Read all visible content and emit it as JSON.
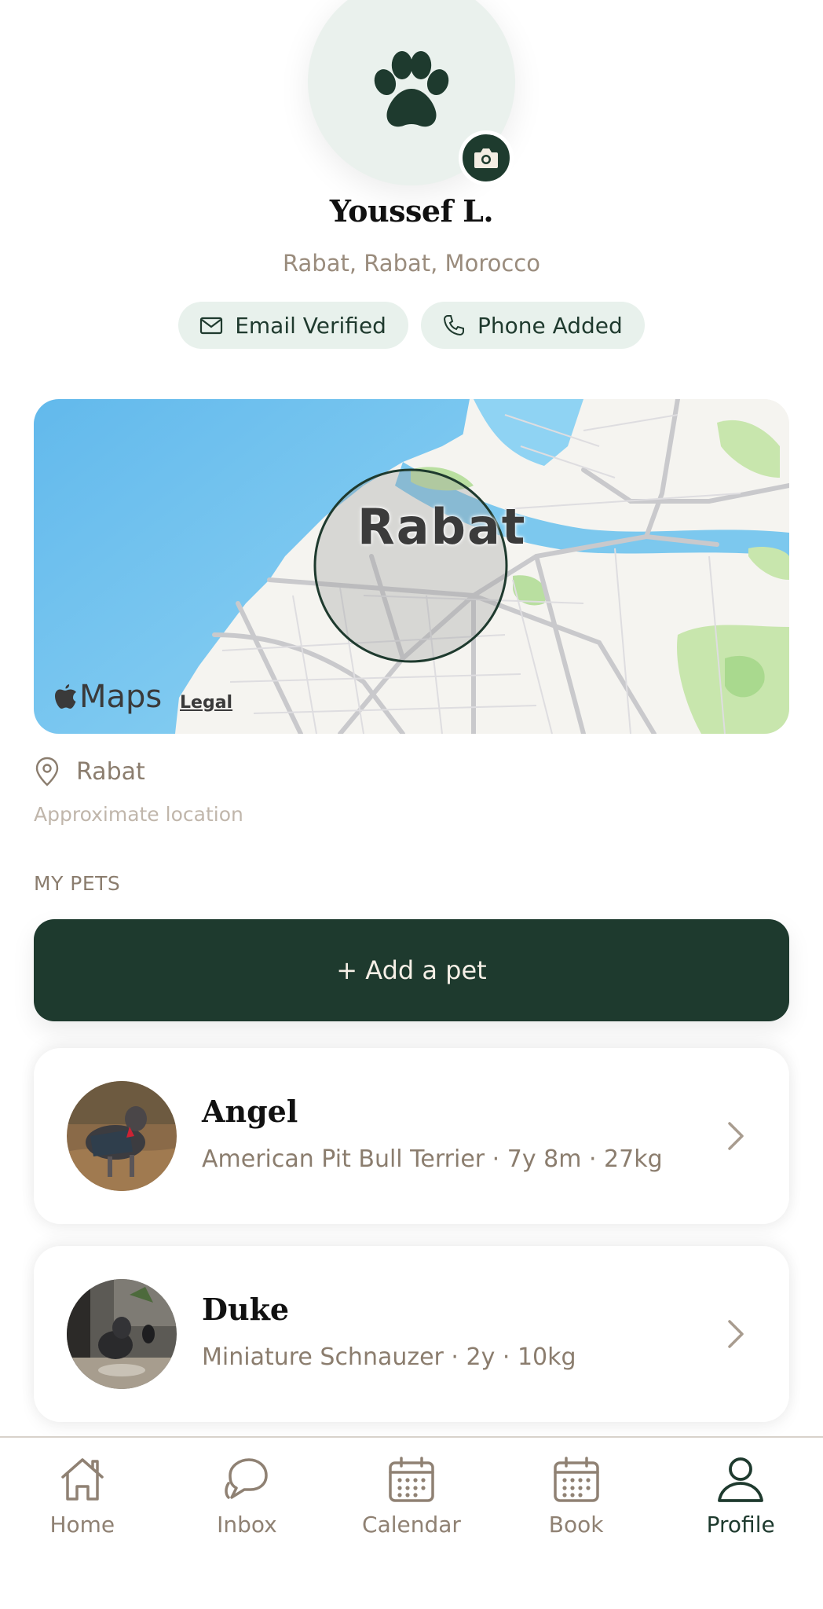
{
  "profile": {
    "name": "Youssef L.",
    "location": "Rabat, Rabat, Morocco",
    "badges": [
      {
        "label": "Email Verified",
        "icon": "mail-icon"
      },
      {
        "label": "Phone Added",
        "icon": "phone-icon"
      }
    ]
  },
  "map": {
    "city_label": "Rabat",
    "brand": "Maps",
    "legal": "Legal",
    "place_name": "Rabat",
    "note": "Approximate location"
  },
  "pets_section": {
    "title": "MY PETS",
    "add_label": "+ Add a pet",
    "pets": [
      {
        "name": "Angel",
        "details": "American Pit Bull Terrier · 7y 8m · 27kg"
      },
      {
        "name": "Duke",
        "details": "Miniature Schnauzer · 2y · 10kg"
      }
    ]
  },
  "tabbar": {
    "active": "Profile",
    "tabs": [
      {
        "label": "Home",
        "icon": "home-icon"
      },
      {
        "label": "Inbox",
        "icon": "chat-bubble-icon"
      },
      {
        "label": "Calendar",
        "icon": "calendar-icon"
      },
      {
        "label": "Book",
        "icon": "calendar-icon"
      },
      {
        "label": "Profile",
        "icon": "user-icon"
      }
    ]
  },
  "colors": {
    "brand_green": "#1e3a2e",
    "muted_brown": "#8b7d6e",
    "chip_bg": "#e8f1ec",
    "water": "#7cc8ee"
  }
}
